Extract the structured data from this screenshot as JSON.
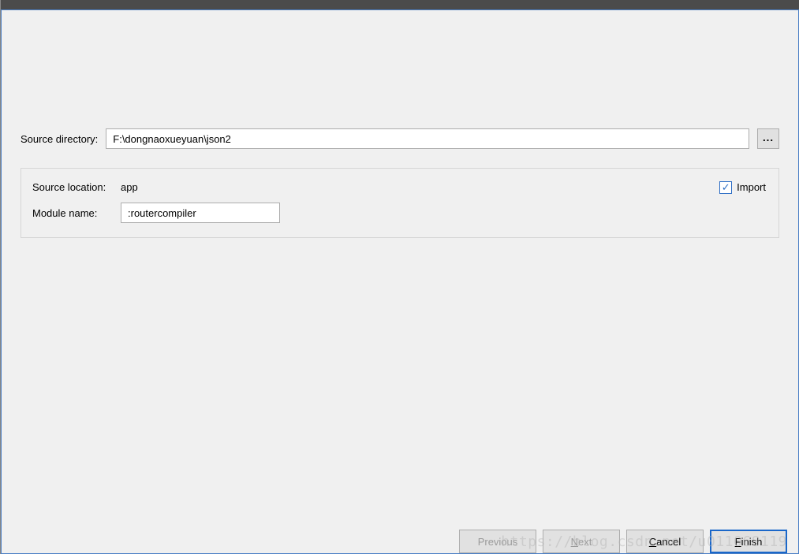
{
  "source_dir_label": "Source directory:",
  "source_dir_value": "F:\\dongnaoxueyuan\\json2",
  "browse_button_label": "...",
  "panel": {
    "source_location_label": "Source location:",
    "source_location_value": "app",
    "module_name_label": "Module name:",
    "module_name_value": ":routercompiler",
    "import_label": "Import",
    "import_checked": true
  },
  "footer": {
    "previous": "Previous",
    "next": "Next",
    "cancel": "Cancel",
    "finish": "Finish"
  },
  "watermark": "https://blog.csdn.net/u011068119"
}
